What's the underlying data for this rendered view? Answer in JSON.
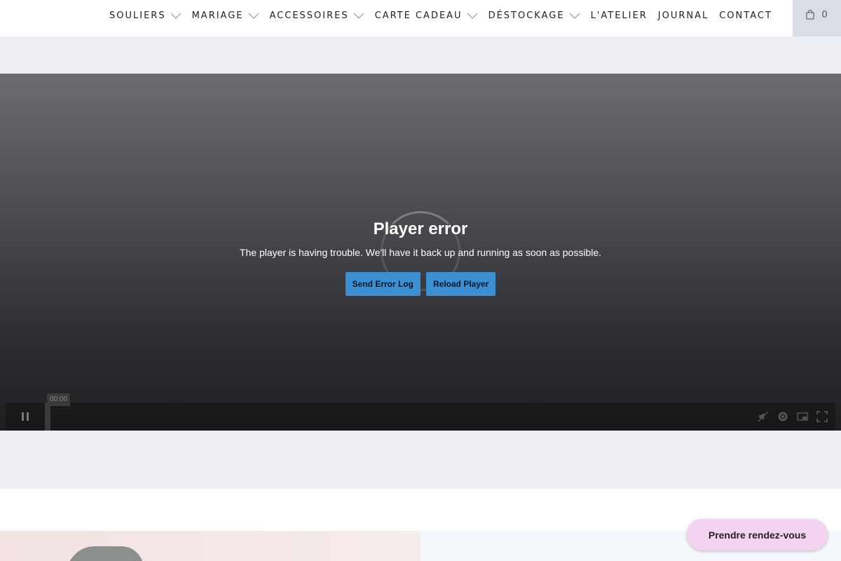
{
  "nav": {
    "items": [
      {
        "label": "SOULIERS",
        "has_dropdown": true
      },
      {
        "label": "MARIAGE",
        "has_dropdown": true
      },
      {
        "label": "ACCESSOIRES",
        "has_dropdown": true
      },
      {
        "label": "CARTE CADEAU",
        "has_dropdown": true
      },
      {
        "label": "DÉSTOCKAGE",
        "has_dropdown": true
      },
      {
        "label": "L'ATELIER",
        "has_dropdown": false
      },
      {
        "label": "JOURNAL",
        "has_dropdown": false
      },
      {
        "label": "CONTACT",
        "has_dropdown": false
      }
    ],
    "cart_count": "0",
    "cart_icon": "shopping-bag-icon"
  },
  "player": {
    "error_title": "Player error",
    "error_message": "The player is having trouble. We'll have it back up and running as soon as possible.",
    "send_log_label": "Send Error Log",
    "reload_label": "Reload Player",
    "time": "00:00",
    "icons": [
      "pause-icon",
      "no-sound-icon",
      "settings-icon",
      "pip-icon",
      "fullscreen-icon"
    ]
  },
  "appointment": {
    "label": "Prendre rendez-vous"
  },
  "colors": {
    "band": "#edeff4",
    "button_blue": "#3b8fd3",
    "appointment_pink": "#f3d3ef"
  }
}
